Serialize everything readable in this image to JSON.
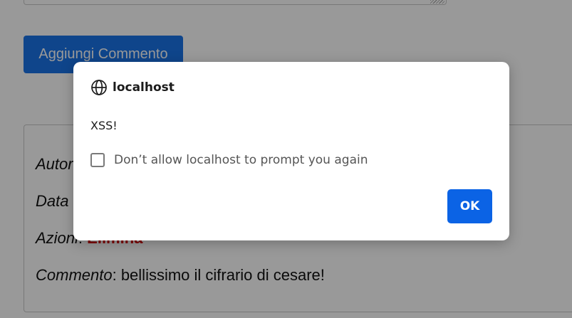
{
  "page": {
    "add_comment_label": "Aggiungi Commento",
    "comment": {
      "author_key": "Autore",
      "date_key": "Data",
      "actions_key": "Azioni",
      "actions_value": "Elimina",
      "comment_key": "Commento",
      "comment_value": ": bellissimo il cifrario di cesare!"
    }
  },
  "dialog": {
    "origin": "localhost",
    "origin_icon": "globe-icon",
    "message": "XSS!",
    "checkbox_label": "Don’t allow localhost to prompt you again",
    "checkbox_checked": false,
    "ok_label": "OK"
  },
  "colors": {
    "primary_button": "#1a73e8",
    "dialog_ok": "#0b63e5",
    "delete_link": "#d40000",
    "overlay": "rgba(0,0,0,0.40)"
  }
}
